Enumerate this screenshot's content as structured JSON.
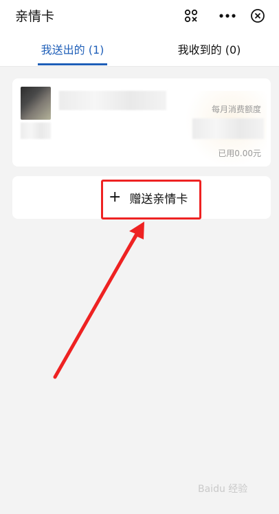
{
  "header": {
    "title": "亲情卡",
    "icons": [
      "scan-icon",
      "more-icon",
      "close-icon"
    ]
  },
  "tabs": [
    {
      "label": "我送出的 (1)",
      "active": true
    },
    {
      "label": "我收到的 (0)",
      "active": false
    }
  ],
  "card": {
    "quota_label": "每月消费额度",
    "used_label": "已用0.00元"
  },
  "gift": {
    "plus": "+",
    "label": "赠送亲情卡"
  },
  "annotation": {
    "highlight_color": "#ee2222"
  },
  "watermark": "Baidu 经验",
  "colors": {
    "accent": "#1f5fb8",
    "background": "#f3f3f3"
  }
}
